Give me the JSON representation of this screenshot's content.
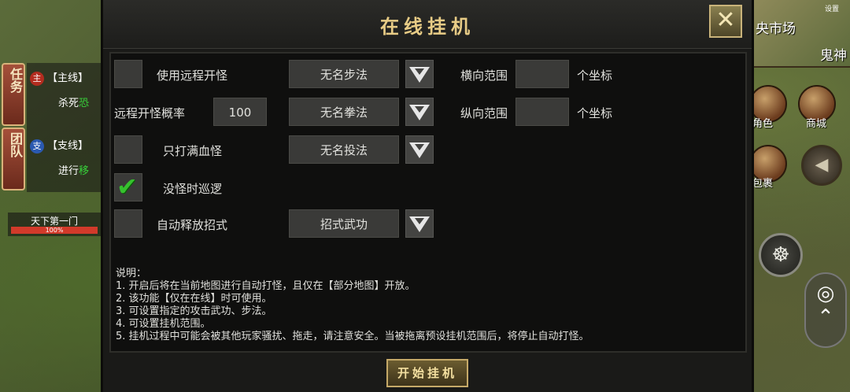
{
  "dialog": {
    "title": "在线挂机",
    "close_icon": "close-icon",
    "start_label": "开始挂机"
  },
  "options": {
    "remote_attack": {
      "label": "使用远程开怪",
      "checked": false
    },
    "remote_rate": {
      "label": "远程开怪概率",
      "value": "100"
    },
    "full_hp_only": {
      "label": "只打满血怪",
      "checked": false
    },
    "patrol": {
      "label": "没怪时巡逻",
      "checked": true
    },
    "auto_skill": {
      "label": "自动释放招式",
      "checked": false
    }
  },
  "dropdowns": {
    "step": "无名步法",
    "fist": "无名拳法",
    "throw": "无名投法",
    "skill": "招式武功"
  },
  "range": {
    "h_label": "横向范围",
    "h_value": "",
    "h_unit": "个坐标",
    "v_label": "纵向范围",
    "v_value": "",
    "v_unit": "个坐标"
  },
  "notes": {
    "heading": "说明：",
    "lines": [
      "1. 开启后将在当前地图进行自动打怪，且仅在【部分地图】开放。",
      "2. 该功能【仅在在线】时可使用。",
      "3. 可设置指定的攻击武功、步法。",
      "4. 可设置挂机范围。",
      "5. 挂机过程中可能会被其他玩家骚扰、拖走，请注意安全。当被拖离预设挂机范围后，将停止自动打怪。"
    ]
  },
  "left_hud": {
    "tab_task": "任务",
    "tab_team": "团队",
    "main_badge": "主",
    "main_tag": "【主线】",
    "main_desc": "杀死",
    "main_desc_hl": "恐",
    "side_badge": "支",
    "side_tag": "【支线】",
    "side_desc": "进行",
    "side_desc_hl": "移",
    "guild_name": "天下第一门",
    "guild_progress_text": "100%",
    "guild_progress": 1.0
  },
  "right_hud": {
    "map_text_a": "央市场",
    "map_text_b": "鬼神",
    "settings": "设置",
    "role_label": "角色",
    "shop_label": "商城",
    "bag_label": "包裹"
  },
  "colors": {
    "title_gold": "#e8cc86",
    "check_green": "#36c12e",
    "panel_bg": "#0f0f0e"
  }
}
